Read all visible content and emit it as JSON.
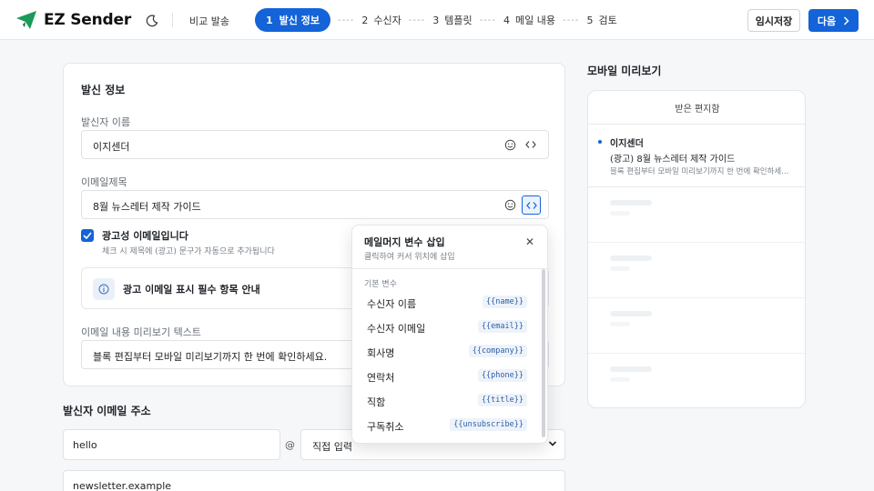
{
  "header": {
    "brand": "EZ Sender",
    "compare_label": "비교 발송",
    "steps": [
      {
        "num": "1",
        "label": "발신 정보"
      },
      {
        "num": "2",
        "label": "수신자"
      },
      {
        "num": "3",
        "label": "템플릿"
      },
      {
        "num": "4",
        "label": "메일 내용"
      },
      {
        "num": "5",
        "label": "검토"
      }
    ],
    "save_label": "임시저장",
    "next_label": "다음",
    "accent": "#1463d8"
  },
  "sender_info": {
    "title": "발신 정보",
    "name_label": "발신자 이름",
    "name_value": "이지센더",
    "subject_label": "이메일제목",
    "subject_value": "8월 뉴스레터 제작 가이드",
    "ad_checkbox_label": "광고성 이메일입니다",
    "ad_checkbox_hint": "체크 시 제목에 (광고) 문구가 자동으로 추가됩니다",
    "ad_checked": true,
    "notice_text": "광고 이메일 표시 필수 항목 안내",
    "preview_label": "이메일 내용 미리보기 텍스트",
    "preview_value": "블록 편집부터 모바일 미리보기까지 한 번에 확인하세요."
  },
  "sender_email": {
    "title": "발신자 이메일 주소",
    "local_value": "hello",
    "at": "@",
    "domain_selected": "직접 입력",
    "custom_domain_value": "newsletter.example"
  },
  "variables_popup": {
    "title": "메일머지 변수 삽입",
    "subtitle": "클릭하여 커서 위치에 삽입",
    "group_label": "기본 변수",
    "items": [
      {
        "name": "수신자 이름",
        "code": "{{name}}"
      },
      {
        "name": "수신자 이메일",
        "code": "{{email}}"
      },
      {
        "name": "회사명",
        "code": "{{company}}"
      },
      {
        "name": "연락처",
        "code": "{{phone}}"
      },
      {
        "name": "직함",
        "code": "{{title}}"
      },
      {
        "name": "구독취소",
        "code": "{{unsubscribe}}"
      }
    ]
  },
  "mobile_preview": {
    "title": "모바일 미리보기",
    "inbox_label": "받은 편지함",
    "mail": {
      "sender": "이지센더",
      "subject": "(광고) 8월 뉴스레터 제작 가이드",
      "preview": "블록 편집부터 모바일 미리보기까지 한 번에 확인하세..."
    }
  }
}
